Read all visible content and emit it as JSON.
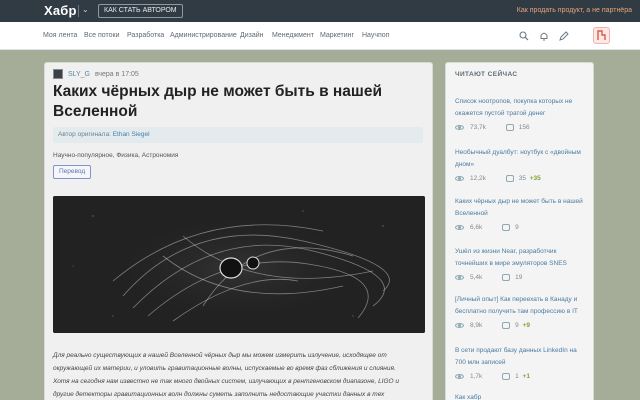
{
  "topbar": {
    "logo": "Хабр",
    "author_button": "КАК СТАТЬ АВТОРОМ",
    "promo": "Как продать продукт, а не партнёра"
  },
  "nav": {
    "items": [
      "Моя лента",
      "Все потоки",
      "Разработка",
      "Администрирование",
      "Дизайн",
      "Менеджмент",
      "Маркетинг",
      "Научпоп"
    ]
  },
  "article": {
    "author": "SLY_G",
    "time": "вчера в 17:05",
    "title": "Каких чёрных дыр не может быть в нашей Вселенной",
    "orig_label": "Автор оригинала:",
    "orig_author": "Ethan Siegel",
    "hubs": "Научно-популярное,  Физика,  Астрономия",
    "tag": "Перевод",
    "body_lines": [
      "Для реально существующих в нашей Вселенной чёрных дыр мы можем измерить излучение, исходящее от",
      "окружающей их материи, и уловить гравитационные волны, испускаемые во время фаз сближения и слияния.",
      "Хотя на сегодня нам известно не так много двойных систем, излучающих в рентгеновском диапазоне, LIGO и",
      "другие детекторы гравитационных волн должны суметь заполнить недостающие участки данных в тех"
    ]
  },
  "sidebar": {
    "heading": "ЧИТАЮТ СЕЙЧАС",
    "items": [
      {
        "title": "Список ноотропов, покупка которых не окажется пустой тратой денег",
        "views": "73,7k",
        "comments": "156",
        "new": ""
      },
      {
        "title": "Необычный дуалбут: ноутбук с «двойным дном»",
        "views": "12,2k",
        "comments": "35",
        "new": "+35"
      },
      {
        "title": "Каких чёрных дыр не может быть в нашей Вселенной",
        "views": "6,6k",
        "comments": "9",
        "new": ""
      },
      {
        "title": "Ушёл из жизни Near, разработчик точнейших в мире эмуляторов SNES",
        "views": "5,4k",
        "comments": "19",
        "new": ""
      },
      {
        "title": "[Личный опыт] Как переехать в Канаду и бесплатно получить там профессию в IT",
        "views": "8,9k",
        "comments": "9",
        "new": "+9"
      },
      {
        "title": "В сети продают базу данных LinkedIn на 700 млн записей",
        "views": "1,7k",
        "comments": "1",
        "new": "+1"
      },
      {
        "title": "Как хабр",
        "views": "",
        "comments": "",
        "new": ""
      }
    ]
  },
  "colors": {
    "topbar": "#303b44",
    "background": "#a5ac98",
    "link": "#4b7ba0",
    "promo": "#e7a37a"
  },
  "icons": {
    "nav": [
      "search-icon",
      "bell-icon",
      "pen-icon",
      "user-icon"
    ]
  }
}
